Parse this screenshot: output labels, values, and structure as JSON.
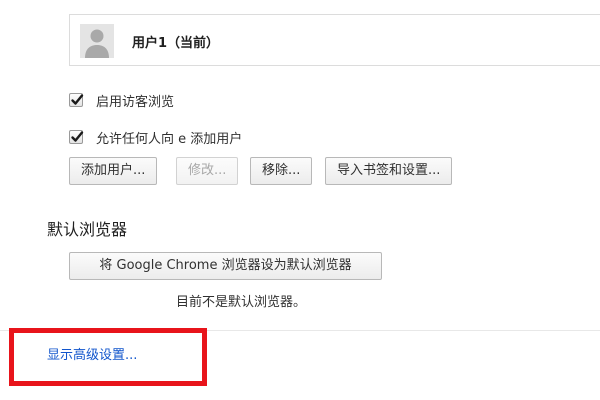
{
  "users": {
    "current_user_label": "用户1（当前）"
  },
  "options": {
    "guest_browsing": {
      "label": "启用访客浏览",
      "checked": true
    },
    "allow_add_user": {
      "label": "允许任何人向 e 添加用户",
      "checked": true
    }
  },
  "buttons": {
    "add_user": "添加用户...",
    "edit": "修改...",
    "remove": "移除...",
    "import": "导入书签和设置..."
  },
  "default_browser": {
    "title": "默认浏览器",
    "set_default_button": "将 Google Chrome 浏览器设为默认浏览器",
    "status": "目前不是默认浏览器。"
  },
  "advanced": {
    "link_label": "显示高级设置..."
  },
  "colors": {
    "link": "#1155cc",
    "highlight": "#e8141b"
  }
}
